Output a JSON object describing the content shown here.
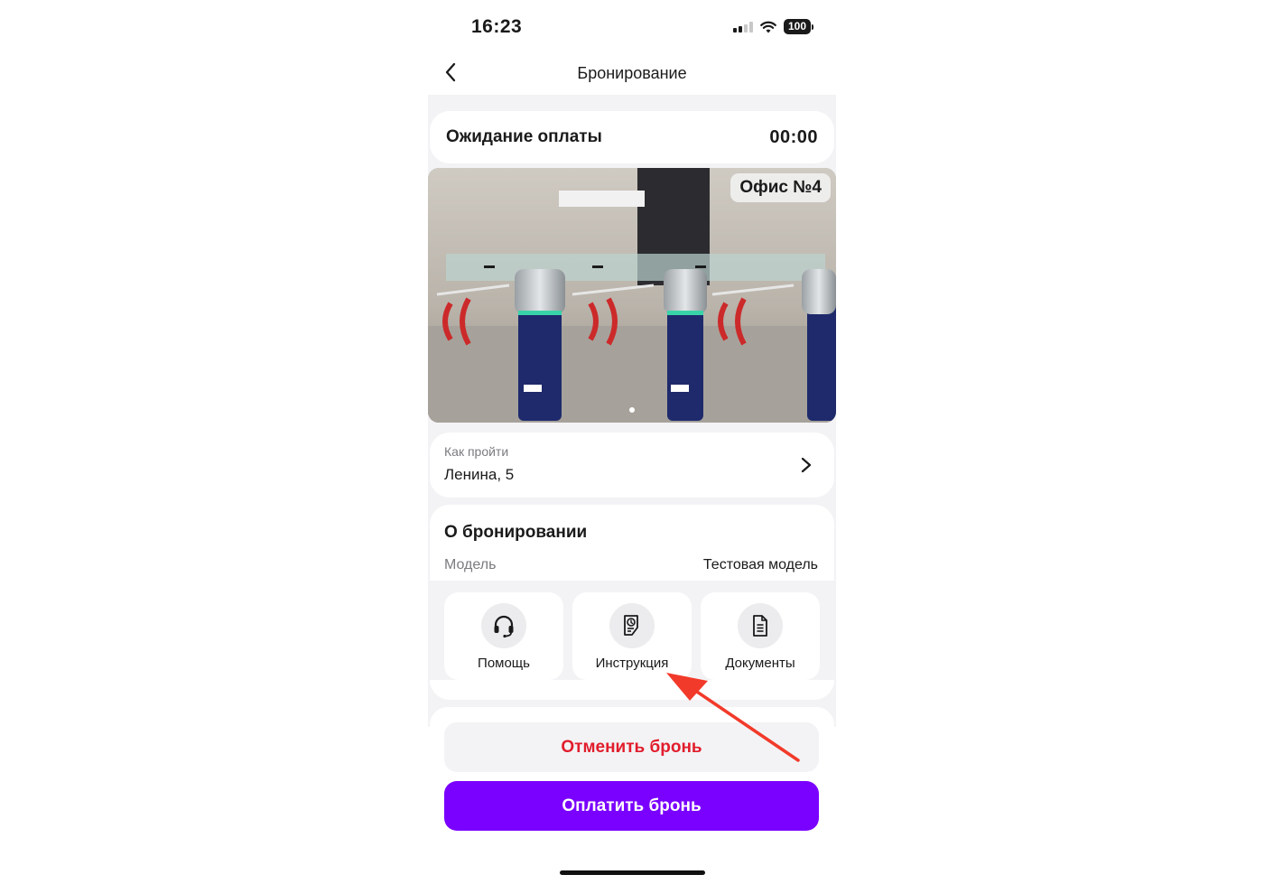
{
  "status_bar": {
    "time": "16:23",
    "battery": "100"
  },
  "header": {
    "title": "Бронирование",
    "back_icon": "chevron-left-icon"
  },
  "payment_status": {
    "label": "Ожидание оплаты",
    "timer": "00:00"
  },
  "photo": {
    "badge": "Офис №4",
    "current_slide": 1,
    "slide_count": 1
  },
  "route": {
    "label": "Как пройти",
    "address": "Ленина, 5",
    "icon": "chevron-right-icon"
  },
  "booking": {
    "title": "О бронировании",
    "model_label": "Модель",
    "model_value": "Тестовая модель"
  },
  "actions": [
    {
      "label": "Помощь",
      "icon": "headset-icon"
    },
    {
      "label": "Инструкция",
      "icon": "instruction-doc-icon"
    },
    {
      "label": "Документы",
      "icon": "document-icon"
    }
  ],
  "buttons": {
    "cancel": "Отменить бронь",
    "pay": "Оплатить бронь"
  },
  "colors": {
    "accent": "#7a00ff",
    "danger": "#e11d2c",
    "annotation": "#f23a2a"
  }
}
